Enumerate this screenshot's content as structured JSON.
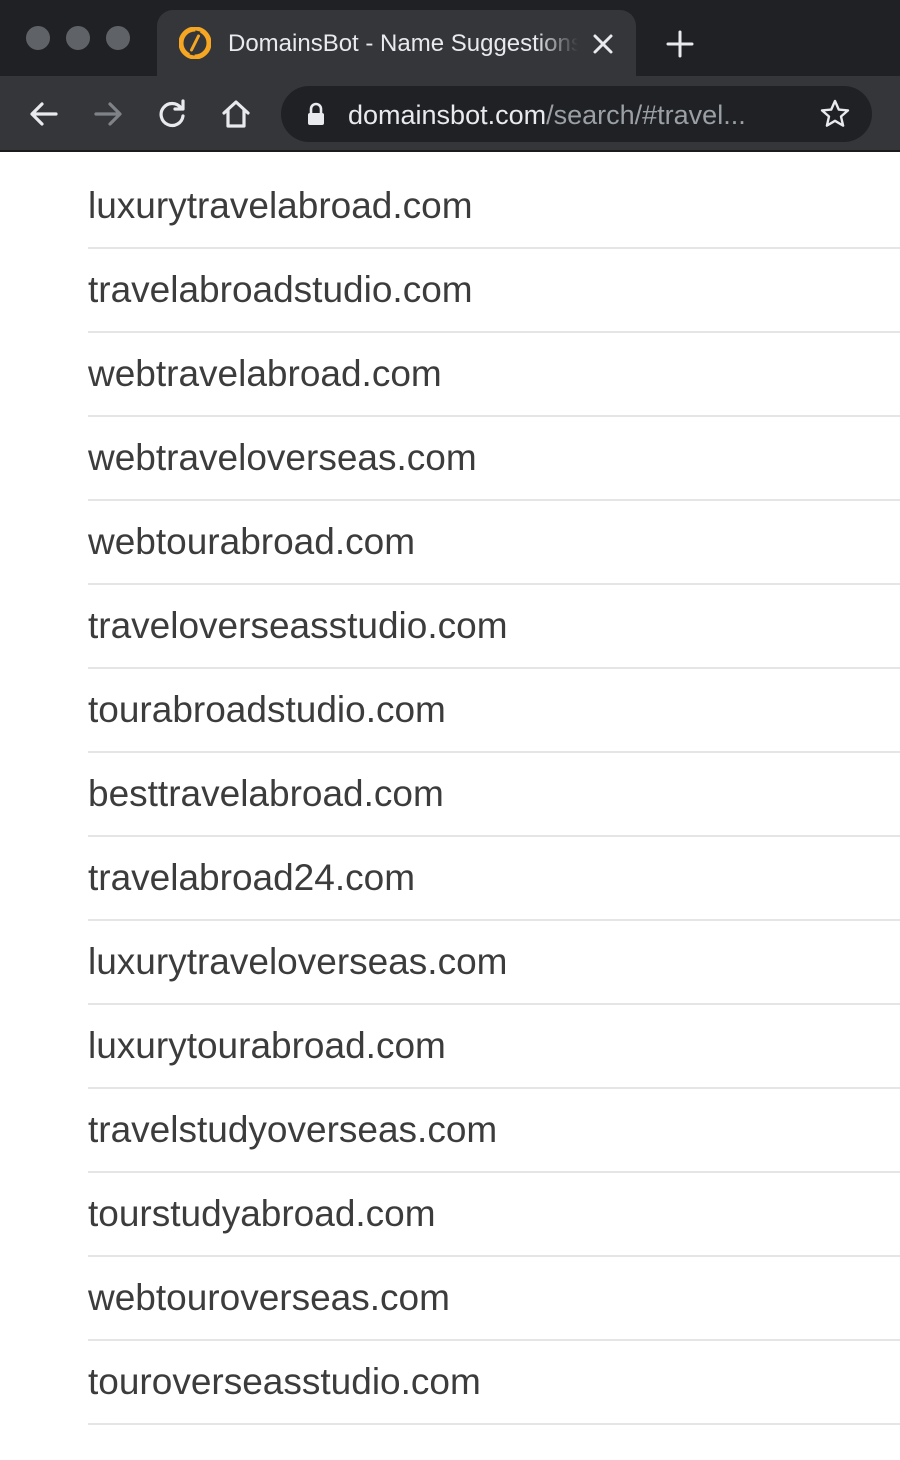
{
  "browser": {
    "tab": {
      "title": "DomainsBot - Name Suggestions",
      "favicon": "domainsbot-logo-icon"
    },
    "address_bar": {
      "host": "domainsbot.com",
      "path": "/search/#travel..."
    },
    "icons": {
      "back": "arrow-left-icon",
      "forward": "arrow-right-icon",
      "reload": "reload-icon",
      "home": "home-icon",
      "lock": "lock-icon",
      "bookmark": "star-icon",
      "close_tab": "close-icon",
      "new_tab": "plus-icon"
    }
  },
  "domains": [
    "luxurytravelabroad.com",
    "travelabroadstudio.com",
    "webtravelabroad.com",
    "webtraveloverseas.com",
    "webtourabroad.com",
    "traveloverseasstudio.com",
    "tourabroadstudio.com",
    "besttravelabroad.com",
    "travelabroad24.com",
    "luxurytraveloverseas.com",
    "luxurytourabroad.com",
    "travelstudyoverseas.com",
    "tourstudyabroad.com",
    "webtouroverseas.com",
    "touroverseasstudio.com"
  ],
  "colors": {
    "chrome_dark": "#202124",
    "chrome_toolbar": "#35363a",
    "favicon_orange": "#f5a623",
    "domain_text": "#3c3c3c",
    "divider": "#e5e5e5"
  }
}
